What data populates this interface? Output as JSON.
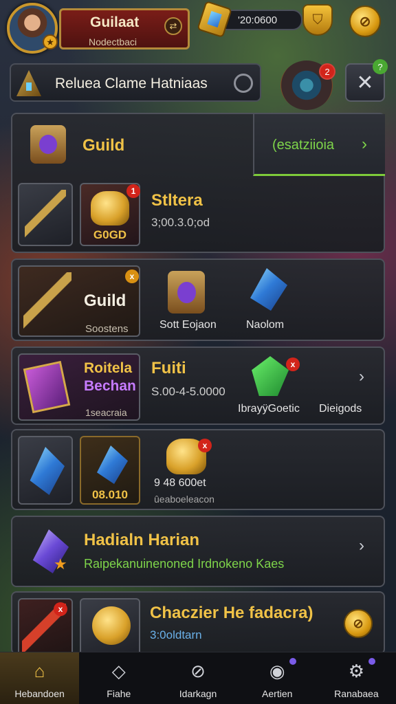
{
  "player": {
    "name": "Guilaat",
    "subtitle": "Nodectbaci",
    "swap_icon": "swap-icon"
  },
  "currency": {
    "gems_value": "'20:0600"
  },
  "search": {
    "text": "Reluea Clame Hatniaas"
  },
  "badges": {
    "portal": "2",
    "close": "?"
  },
  "panel1": {
    "title": "Guild",
    "action_label": "(esatziioia",
    "item_title": "Stltera",
    "item_value": "3;00.3.0;od",
    "item_tile_label": "G0GD",
    "badge": "1"
  },
  "panel2": {
    "title": "Guild",
    "tile_sub": "Soostens",
    "item1_label": "Sott Eojaon",
    "item2_label": "Naolom",
    "badge": "x"
  },
  "panel3": {
    "tile_title_1": "Roitela",
    "tile_title_2": "Bechan",
    "tile_sub": "1seacraia",
    "title": "Fuiti",
    "value": "S.00-4-5.0000",
    "item1_label": "IbrayÿGoetic",
    "item2_label": "Dieigods",
    "badge": "x"
  },
  "panel4": {
    "tile_label": "08.010",
    "value": "9 48 600et",
    "sub": "ûeaboeleacon",
    "badge": "x"
  },
  "panel5": {
    "title": "Hadialn Harian",
    "sub": "Raipekanuinenoned Irdnokeno Kaes"
  },
  "panel6": {
    "title": "Chaczier He fadacra)",
    "sub": "3:0oldtarn"
  },
  "nav": [
    {
      "label": "Hebandoen",
      "icon": "home-icon",
      "active": true
    },
    {
      "label": "Fiahe",
      "icon": "search-diamond-icon",
      "active": false
    },
    {
      "label": "Idarkagn",
      "icon": "compass-icon",
      "active": false
    },
    {
      "label": "Aertien",
      "icon": "camera-icon",
      "active": false
    },
    {
      "label": "Ranabaea",
      "icon": "gear-icon",
      "active": false
    }
  ]
}
